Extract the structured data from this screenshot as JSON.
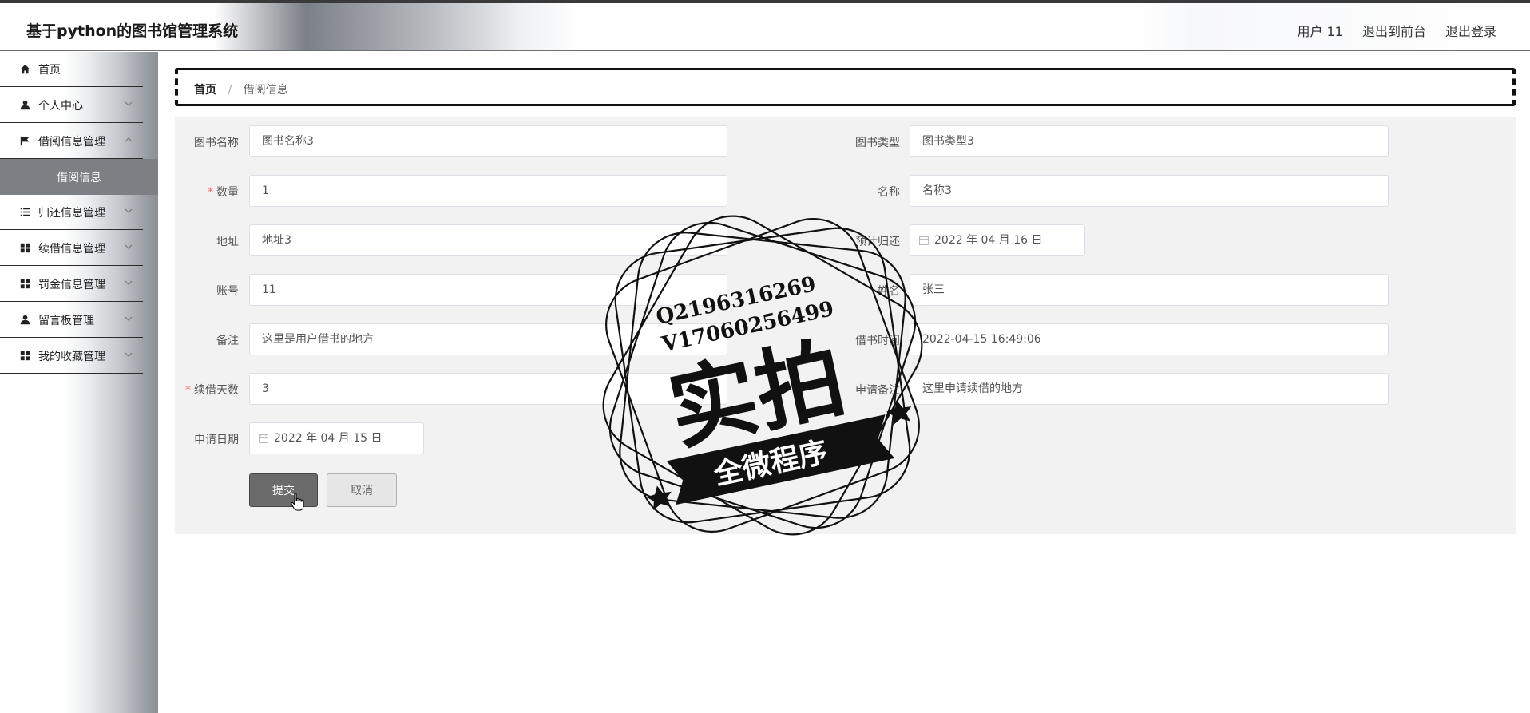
{
  "header": {
    "app_title": "基于python的图书馆管理系统",
    "user_label": "用户 11",
    "to_frontend": "退出到前台",
    "logout": "退出登录"
  },
  "sidebar": {
    "items": [
      {
        "label": "首页",
        "icon": "home-icon"
      },
      {
        "label": "个人中心",
        "icon": "user-icon"
      },
      {
        "label": "借阅信息管理",
        "icon": "flag-icon"
      },
      {
        "label": "归还信息管理",
        "icon": "list-icon"
      },
      {
        "label": "续借信息管理",
        "icon": "grid-icon"
      },
      {
        "label": "罚金信息管理",
        "icon": "grid-icon"
      },
      {
        "label": "留言板管理",
        "icon": "user-icon"
      },
      {
        "label": "我的收藏管理",
        "icon": "grid-icon"
      }
    ],
    "active_submenu": "借阅信息"
  },
  "breadcrumb": {
    "home": "首页",
    "separator": "/",
    "current": "借阅信息"
  },
  "form": {
    "book_name": {
      "label": "图书名称",
      "value": "图书名称3"
    },
    "book_type": {
      "label": "图书类型",
      "value": "图书类型3"
    },
    "quantity": {
      "label": "数量",
      "value": "1",
      "required": true
    },
    "name": {
      "label": "名称",
      "value": "名称3"
    },
    "address": {
      "label": "地址",
      "value": "地址3"
    },
    "expected_return": {
      "label": "预计归还",
      "value": "2022 年 04 月 16 日"
    },
    "account": {
      "label": "账号",
      "value": "11"
    },
    "full_name": {
      "label": "姓名",
      "value": "张三"
    },
    "remark": {
      "label": "备注",
      "value": "这里是用户借书的地方"
    },
    "borrow_time": {
      "label": "借书时间",
      "value": "2022-04-15 16:49:06"
    },
    "renew_days": {
      "label": "续借天数",
      "value": "3",
      "required": true
    },
    "apply_remark": {
      "label": "申请备注",
      "value": "这里申请续借的地方"
    },
    "apply_date": {
      "label": "申请日期",
      "value": "2022 年 04 月 15 日"
    },
    "submit_label": "提交",
    "cancel_label": "取消",
    "required_mark": "*"
  },
  "watermark": {
    "qq": "Q2196316269",
    "wechat": "V17060256499",
    "main_text": "实拍",
    "ribbon_text": "全微程序"
  },
  "colors": {
    "submit_bg": "#6b6b6b",
    "submenu_bg": "#7c7f84",
    "required": "#f56c6c",
    "panel_bg": "#f2f2f2"
  }
}
